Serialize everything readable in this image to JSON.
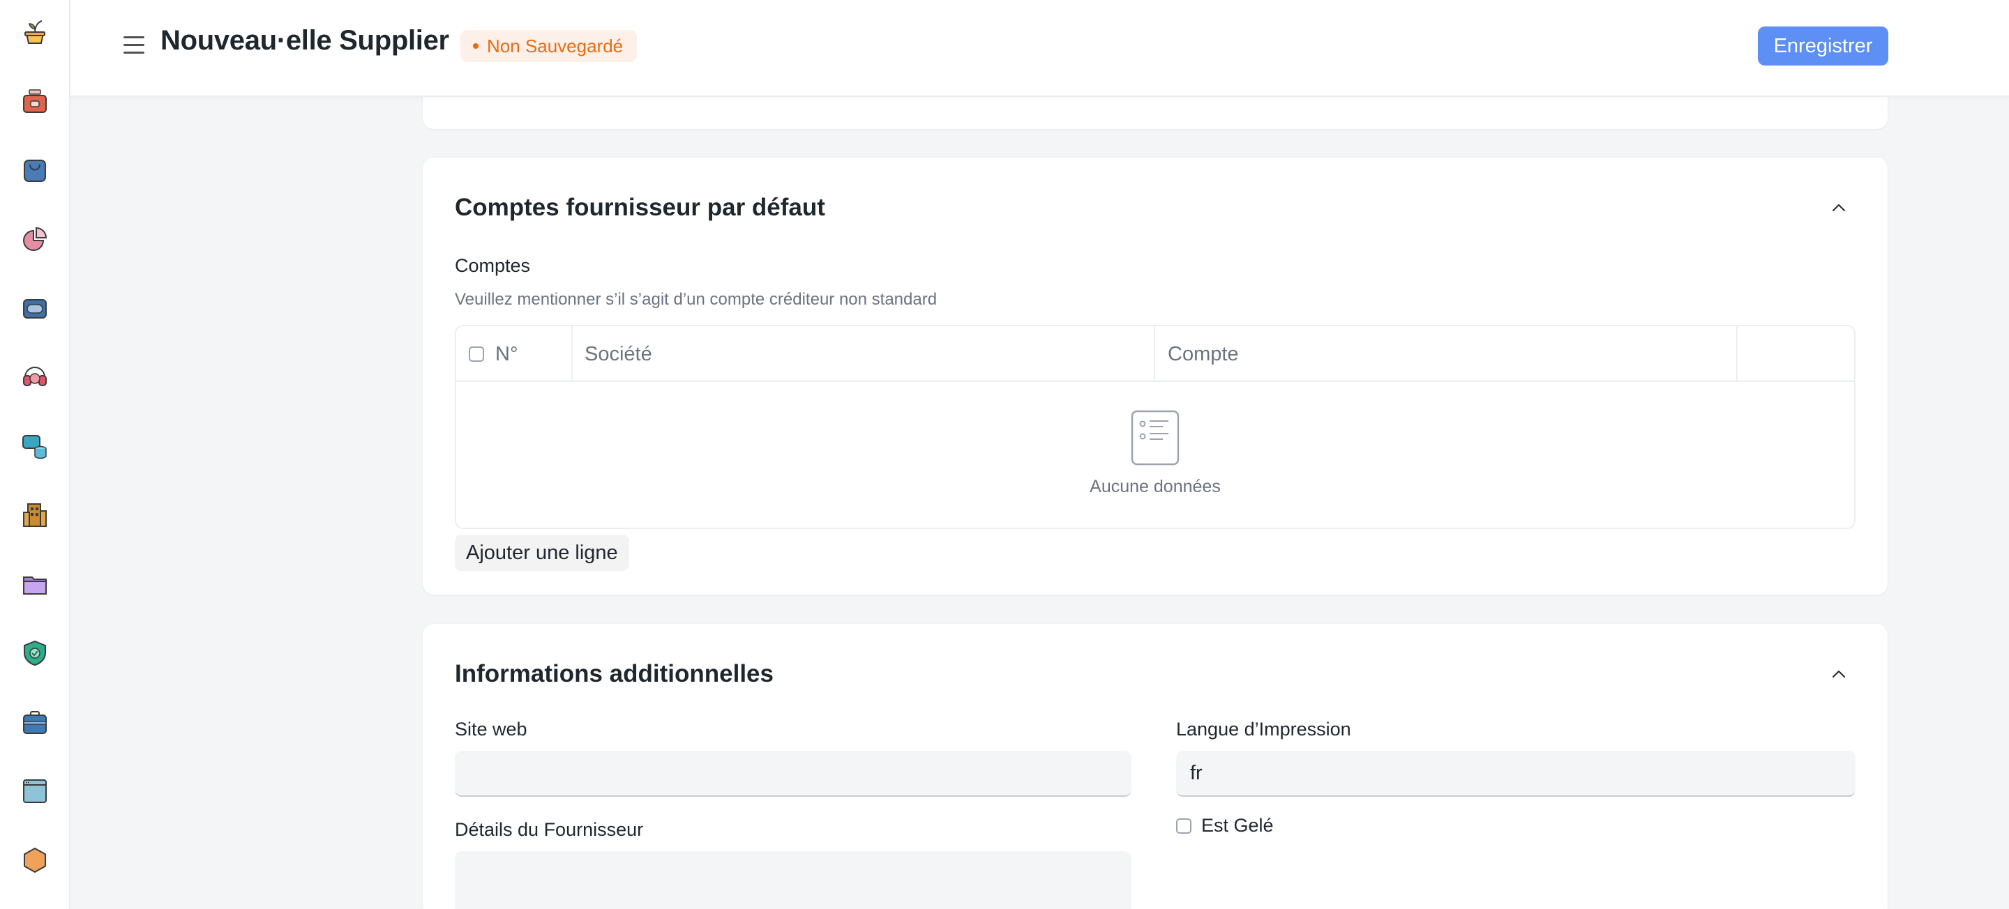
{
  "header": {
    "title": "Nouveau·elle Supplier",
    "status": "Non Sauvegardé",
    "save_label": "Enregistrer"
  },
  "sidebar": {
    "icons": [
      "plant-pot-icon",
      "cash-register-icon",
      "shopping-bag-icon",
      "pie-chart-icon",
      "billing-icon",
      "headset-support-icon",
      "database-chat-icon",
      "building-icon",
      "folder-icon",
      "shield-check-icon",
      "briefcase-icon",
      "browser-window-icon",
      "hexagon-icon"
    ]
  },
  "accounts": {
    "title": "Comptes fournisseur par défaut",
    "label": "Comptes",
    "description": "Veuillez mentionner s’il s’agit d’un compte créditeur non standard",
    "columns": [
      "N°",
      "Société",
      "Compte"
    ],
    "empty": "Aucune données",
    "add_row": "Ajouter une ligne"
  },
  "info": {
    "title": "Informations additionnelles",
    "website_label": "Site web",
    "website_value": "",
    "language_label": "Langue d’Impression",
    "language_value": "fr",
    "frozen_label": "Est Gelé",
    "details_label": "Détails du Fournisseur",
    "details_value": ""
  },
  "colors": {
    "primary": "#5e8ff5",
    "warning": "#e86c13",
    "warning_bg": "#fdf0e8"
  }
}
